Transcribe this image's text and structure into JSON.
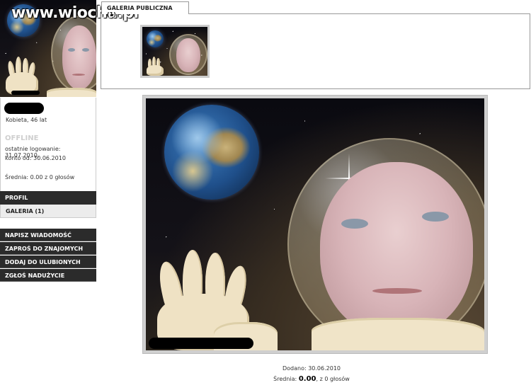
{
  "watermark": "www.wiocha.pl",
  "profile": {
    "info": "Kobieta, 46 lat",
    "status": "OFFLINE",
    "last_login": "ostatnie logowanie: 31.07.2010,",
    "account_since": "konto od: 30.06.2010",
    "rating": "Średnia: 0.00 z 0 głosów"
  },
  "nav": {
    "profil": "PROFIL",
    "galeria": "GALERIA (1)"
  },
  "actions": [
    "NAPISZ WIADOMOŚĆ",
    "ZAPROŚ DO ZNAJOMYCH",
    "DODAJ DO ULUBIONYCH",
    "ZGŁOŚ NADUŻYCIE"
  ],
  "gallery": {
    "tab_label": "GALERIA PUBLICZNA (1)"
  },
  "photo": {
    "added": "Dodano: 30.06.2010",
    "rating_prefix": "Średnia:",
    "rating_value": "0.00",
    "rating_suffix": ", z 0 głosów"
  }
}
